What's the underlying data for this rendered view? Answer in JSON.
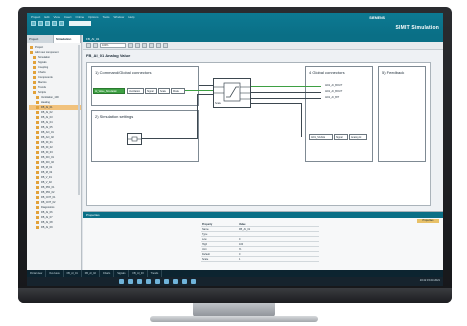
{
  "app": {
    "menu": [
      "Project",
      "Edit",
      "View",
      "Insert",
      "Online",
      "Options",
      "Tools",
      "Window",
      "Help"
    ],
    "brand": "SIEMENS",
    "product": "SIMIT Simulation"
  },
  "left_panel": {
    "tabs": [
      "Project",
      "Simulation"
    ],
    "tree": [
      {
        "label": "Project"
      },
      {
        "label": "Add new component"
      },
      {
        "label": "Simulation"
      },
      {
        "label": "Signals"
      },
      {
        "label": "Coupling"
      },
      {
        "label": "Charts"
      },
      {
        "label": "Components"
      },
      {
        "label": "Macros"
      },
      {
        "label": "Trends"
      },
      {
        "label": "Scripts"
      },
      {
        "label": "Ventilation_100"
      },
      {
        "label": "Heating"
      },
      {
        "label": "FB_AI_01"
      },
      {
        "label": "FB_AI_02"
      },
      {
        "label": "FB_AI_03"
      },
      {
        "label": "FB_AI_04"
      },
      {
        "label": "FB_AI_05"
      },
      {
        "label": "FB_AO_01"
      },
      {
        "label": "FB_AO_02"
      },
      {
        "label": "FB_DI_01"
      },
      {
        "label": "FB_DI_02"
      },
      {
        "label": "FB_DI_03"
      },
      {
        "label": "FB_DO_01"
      },
      {
        "label": "FB_DO_02"
      },
      {
        "label": "FB_M_01"
      },
      {
        "label": "FB_M_02"
      },
      {
        "label": "FB_V_01"
      },
      {
        "label": "FB_V_02"
      },
      {
        "label": "FB_PID_01"
      },
      {
        "label": "FB_PID_02"
      },
      {
        "label": "FB_CNT_01"
      },
      {
        "label": "FB_CNT_02"
      },
      {
        "label": "Diagnostics"
      },
      {
        "label": "FB_AI_06"
      },
      {
        "label": "FB_AI_07"
      },
      {
        "label": "FB_AI_08"
      },
      {
        "label": "FB_AI_09"
      }
    ]
  },
  "document": {
    "tab": "FB_AI_01",
    "zoom": "100%",
    "title": "FB_AI_01 Analog Value",
    "regions": {
      "connectors": "1) Command/Global connectors",
      "simulation": "2) Simulation settings",
      "global": "4 Global connectors",
      "feedback": "5) Feedback"
    },
    "green_signal": "AI_Value_Simulation",
    "params": [
      "Ventilation",
      "Signal",
      "Scale",
      "Mode"
    ],
    "outputs": [
      "AI01_AI_BOUT",
      "AI01_AI_BOUT",
      "AI01_AI_BIT"
    ],
    "bottom_boxes": [
      "AI01_SCALE",
      "Signal",
      "Analog AI"
    ],
    "center_label": "Scale"
  },
  "properties": {
    "header": "Properties",
    "side_tab": "Properties",
    "columns": [
      "Property",
      "Value"
    ],
    "rows": [
      {
        "name": "Name",
        "value": "FB_AI_01"
      },
      {
        "name": "Type",
        "value": ""
      },
      {
        "name": "Low",
        "value": "0"
      },
      {
        "name": "High",
        "value": "100"
      },
      {
        "name": "Unit",
        "value": "%"
      },
      {
        "name": "Default",
        "value": "0"
      },
      {
        "name": "Scale",
        "value": "1"
      }
    ]
  },
  "portal_tabs": [
    "Portal view",
    "Overview",
    "FB_AI_01",
    "FB_AI_02",
    "Charts",
    "Signals",
    "FB_AI_03",
    "Trends"
  ],
  "clock": "10:42 15.03.2021"
}
